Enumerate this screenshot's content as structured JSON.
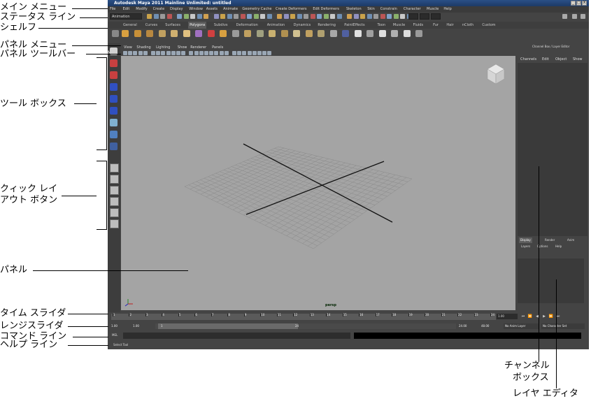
{
  "window": {
    "title": "Autodesk Maya 2011 Mainline Unlimited: untitled",
    "buttons": [
      "_",
      "□",
      "X"
    ]
  },
  "main_menu": [
    "File",
    "Edit",
    "Modify",
    "Create",
    "Display",
    "Window",
    "Assets",
    "Animate",
    "Geometry Cache",
    "Create Deformers",
    "Edit Deformers",
    "Skeleton",
    "Skin",
    "Constrain",
    "Character",
    "Muscle",
    "Help"
  ],
  "status_line": {
    "mode": "Animation"
  },
  "shelf_tabs": [
    "General",
    "Curves",
    "Surfaces",
    "Polygons",
    "Subdivs",
    "Deformation",
    "Animation",
    "Dynamics",
    "Rendering",
    "PaintEffects",
    "Toon",
    "Muscle",
    "Fluids",
    "Fur",
    "Hair",
    "nCloth",
    "Custom"
  ],
  "active_shelf_tab": "Polygons",
  "panel_menu": [
    "View",
    "Shading",
    "Lighting",
    "Show",
    "Renderer",
    "Panels"
  ],
  "viewport": {
    "camera_label": "persp"
  },
  "channel_box": {
    "title": "Channel Box / Layer Editor",
    "menu": [
      "Channels",
      "Edit",
      "Object",
      "Show"
    ]
  },
  "layer_editor": {
    "tabs": [
      "Display",
      "Render",
      "Anim"
    ],
    "menu": [
      "Layers",
      "Options",
      "Help"
    ]
  },
  "time_slider": {
    "ticks": [
      "1",
      "2",
      "3",
      "4",
      "5",
      "6",
      "7",
      "8",
      "9",
      "10",
      "11",
      "12",
      "13",
      "14",
      "15",
      "16",
      "17",
      "18",
      "19",
      "20",
      "21",
      "22",
      "23",
      "24"
    ],
    "current_frame": "1.00"
  },
  "range_slider": {
    "start": "1.00",
    "playback_start": "1.00",
    "range_marker_start": "1",
    "range_marker_end": "24",
    "playback_end": "24.00",
    "end": "48.00",
    "anim_layer": "No Anim Layer",
    "character_set": "No Character Set"
  },
  "command_line": {
    "label": "MEL"
  },
  "help_line": {
    "text": "Select Tool"
  },
  "callouts": {
    "main_menu": "メイン メニュー",
    "status_line": "ステータス ライン",
    "shelf": "シェルフ",
    "panel_menu": "パネル メニュー",
    "panel_toolbar": "パネル ツールバー",
    "toolbox": "ツール ボックス",
    "quick_layout_1": "クィック レイ",
    "quick_layout_2": "アウト ボタン",
    "panel": "パネル",
    "time_slider": "タイム スライダ",
    "range_slider": "レンジスライダ",
    "command_line": "コマンド ライン",
    "help_line": "ヘルプ ライン",
    "channel_box_1": "チャンネル",
    "channel_box_2": "ボックス",
    "layer_editor": "レイヤ エディタ"
  }
}
